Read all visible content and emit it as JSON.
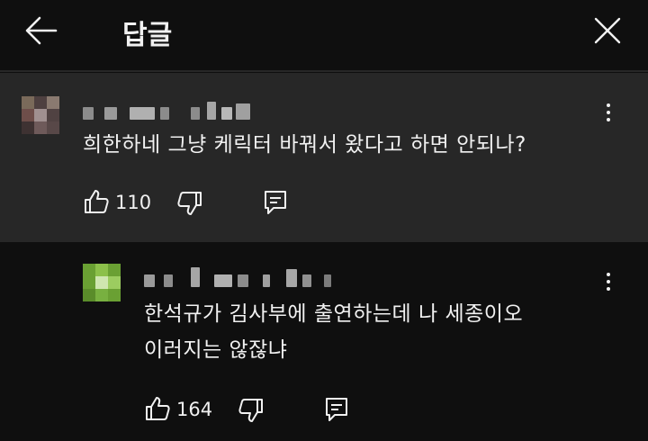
{
  "header": {
    "title": "답글"
  },
  "parent_comment": {
    "text": "희한하네 그냥 케릭터 바꿔서 왔다고 하면 안되나?",
    "likes": "110"
  },
  "reply_comment": {
    "text_line1": "한석규가 김사부에 출연하는데 나 세종이오",
    "text_line2": "이러지는 않잖냐",
    "likes": "164"
  },
  "icons": {
    "back": "arrow-left-icon",
    "close": "close-icon",
    "like": "thumbs-up-icon",
    "dislike": "thumbs-down-icon",
    "reply": "reply-comment-icon",
    "menu": "more-vertical-icon"
  },
  "colors": {
    "background": "#0f0f0f",
    "highlight": "#272727",
    "text": "#f1f1f1"
  }
}
